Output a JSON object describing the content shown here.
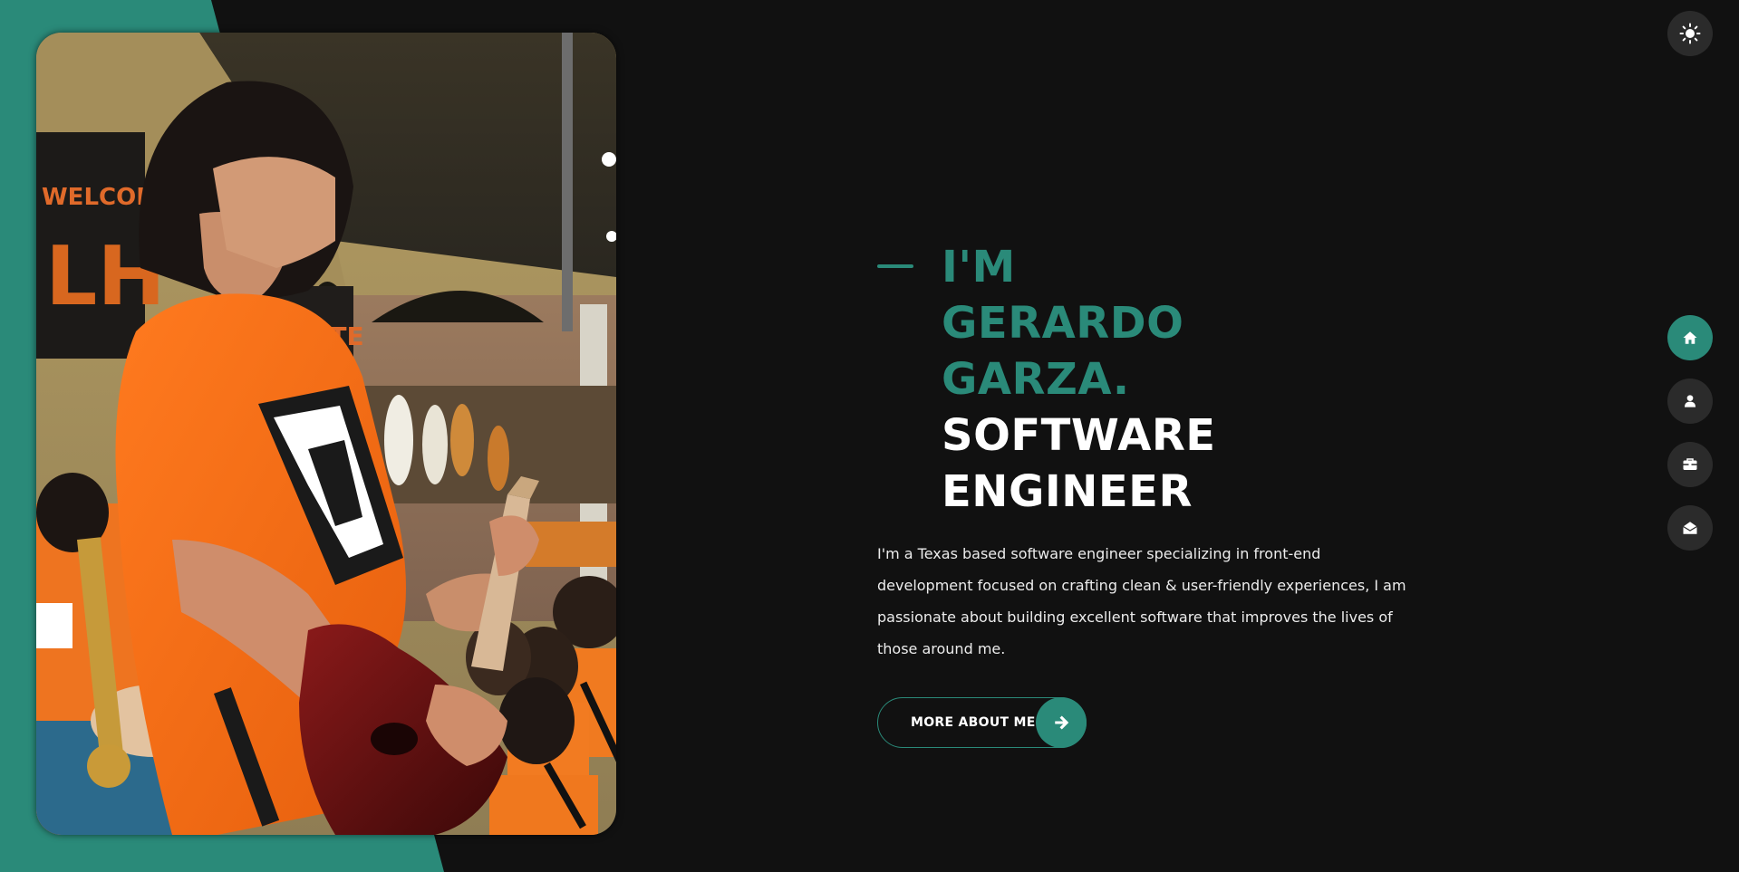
{
  "hero": {
    "name_line": "I'm Gerardo Garza.",
    "role_line": "Software Engineer",
    "intro": "I'm a Texas based software engineer specializing in front-end development focused on crafting clean & user-friendly experiences, I am passionate about building excellent software that improves the lives of those around me.",
    "cta_label": "MORE ABOUT ME"
  },
  "icons": {
    "theme_toggle": "sun-icon",
    "cta_arrow": "arrow-right-icon",
    "nav": [
      "home-icon",
      "user-icon",
      "briefcase-icon",
      "envelope-open-icon"
    ]
  },
  "colors": {
    "accent": "#2a8a79",
    "background": "#111111",
    "nav_button": "#2b2b2b"
  }
}
